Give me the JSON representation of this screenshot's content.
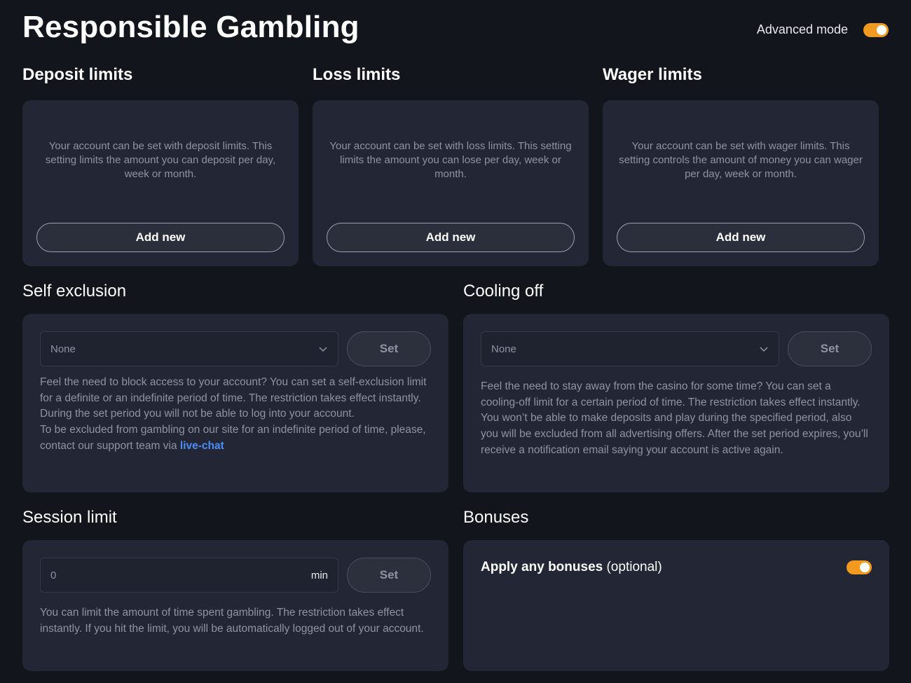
{
  "header": {
    "title": "Responsible Gambling",
    "advanced_mode_label": "Advanced mode",
    "advanced_mode_on": true
  },
  "limits": [
    {
      "title": "Deposit limits",
      "description": "Your account can be set with deposit limits. This setting limits the amount you can deposit per day, week or month.",
      "button": "Add new"
    },
    {
      "title": "Loss limits",
      "description": "Your account can be set with loss limits. This setting limits the amount you can lose per day, week or month.",
      "button": "Add new"
    },
    {
      "title": "Wager limits",
      "description": "Your account can be set with wager limits. This setting controls the amount of money you can wager per day, week or month.",
      "button": "Add new"
    }
  ],
  "self_exclusion": {
    "title": "Self exclusion",
    "selected": "None",
    "set_label": "Set",
    "description_1": "Feel the need to block access to your account? You can set a self-exclusion limit for a definite or an indefinite period of time. The restriction takes effect instantly. During the set period you will not be able to log into your account.",
    "description_2": "To be excluded from gambling on our site for an indefinite period of time, please, contact our support team via",
    "link": "live-chat"
  },
  "cooling_off": {
    "title": "Cooling off",
    "selected": "None",
    "set_label": "Set",
    "description": "Feel the need to stay away from the casino for some time? You can set a cooling-off limit for a certain period of time. The restriction takes effect instantly. You won’t be able to make deposits and play during the specified period, also you will be excluded from all advertising offers. After the set period expires, you’ll receive a notification email saying your account is active again."
  },
  "session_limit": {
    "title": "Session limit",
    "value": "0",
    "unit": "min",
    "set_label": "Set",
    "description": "You can limit the amount of time spent gambling. The restriction takes effect instantly. If you hit the limit, you will be automatically logged out of your account."
  },
  "bonuses": {
    "title": "Bonuses",
    "label_bold": "Apply any bonuses",
    "label_optional": "(optional)",
    "enabled": true
  },
  "colors": {
    "background": "#13151c",
    "card": "#232735",
    "accent_toggle": "#f19a1f",
    "link": "#4c8df5",
    "muted_text": "#8e93a3"
  }
}
